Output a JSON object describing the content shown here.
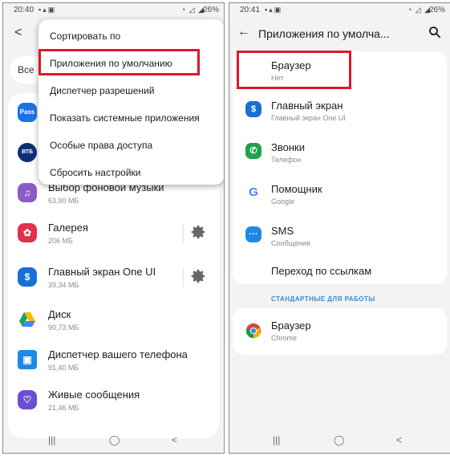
{
  "left": {
    "status": {
      "time": "20:40",
      "battery": "26%"
    },
    "search_label": "Все",
    "menu": {
      "items": [
        "Сортировать по",
        "Приложения по умолчанию",
        "Диспетчер разрешений",
        "Показать системные приложения",
        "Особые права доступа",
        "Сбросить настройки"
      ]
    },
    "apps": [
      {
        "name": "Выбор фоновой музыки",
        "size": "63,90 МБ",
        "color": "#8a5cc9",
        "icon": "music-icon"
      },
      {
        "name": "Галерея",
        "size": "206 МБ",
        "color": "#e2314a",
        "icon": "flower-icon"
      },
      {
        "name": "Главный экран One UI",
        "size": "39,34 МБ",
        "color": "#1a6fd6",
        "icon": "one-ui-home-icon"
      },
      {
        "name": "Диск",
        "size": "90,73 МБ",
        "color": "#ffffff",
        "icon": "drive-icon"
      },
      {
        "name": "Диспетчер вашего телефона",
        "size": "91,40 МБ",
        "color": "#1e88e5",
        "icon": "phone-companion-icon"
      },
      {
        "name": "Живые сообщения",
        "size": "21,46 МБ",
        "color": "#6a4fd3",
        "icon": "heart-message-icon"
      }
    ]
  },
  "right": {
    "status": {
      "time": "20:41",
      "battery": "26%"
    },
    "title": "Приложения по умолча...",
    "items": [
      {
        "name": "Браузер",
        "sub": "Нет"
      },
      {
        "name": "Главный экран",
        "sub": "Главный экран One UI",
        "color": "#1a6fd6",
        "icon": "home-app-icon"
      },
      {
        "name": "Звонки",
        "sub": "Телефон",
        "color": "#1ea24a",
        "icon": "phone-icon"
      },
      {
        "name": "Помощник",
        "sub": "Google",
        "color": "#ffffff",
        "icon": "google-icon"
      },
      {
        "name": "SMS",
        "sub": "Сообщения",
        "color": "#1e88e5",
        "icon": "messages-icon"
      },
      {
        "name": "Переход по ссылкам",
        "sub": ""
      }
    ],
    "work_section": "СТАНДАРТНЫЕ ДЛЯ РАБОТЫ",
    "work_item": {
      "name": "Браузер",
      "sub": "Chrome",
      "icon": "chrome-icon"
    }
  },
  "colors": {
    "highlight": "#e0162b",
    "accent": "#3a8bc9"
  }
}
